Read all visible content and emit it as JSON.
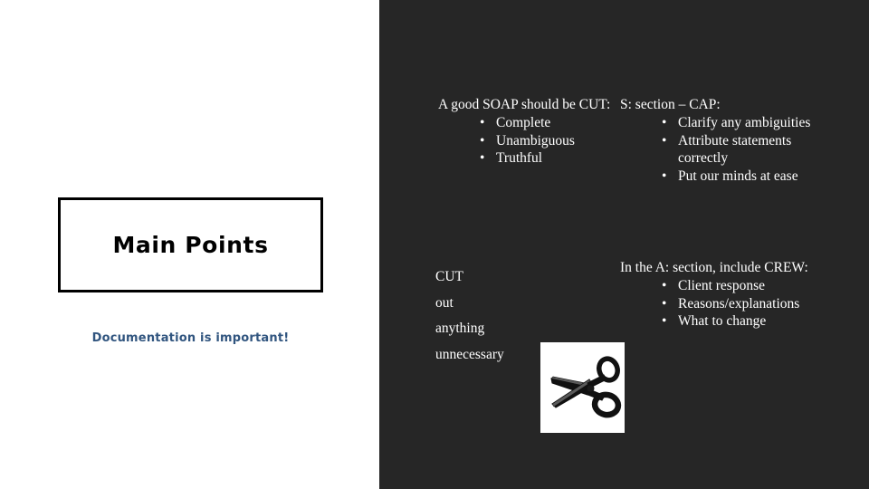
{
  "slide": {
    "title": "Main Points",
    "subtitle": "Documentation is important!",
    "accent_color": "#31557f",
    "panel_color": "#262626",
    "text_color": "#ffffff"
  },
  "columns": {
    "soap": {
      "lead": "A good SOAP should be CUT:",
      "bullet_glyph": "•",
      "bullets": [
        "Complete",
        "Unambiguous",
        "Truthful"
      ]
    },
    "cap": {
      "lead": "S: section – CAP:",
      "bullet_glyph": "•",
      "bullets": [
        "Clarify any ambiguities",
        "Attribute statements correctly",
        "Put our minds at ease"
      ]
    },
    "cut_out": {
      "lines": [
        "CUT",
        "out",
        "anything",
        "unnecessary"
      ]
    },
    "crew": {
      "lead": "In the A: section, include CREW:",
      "bullet_glyph": "•",
      "bullets": [
        "Client response",
        "Reasons/explanations",
        "What to change"
      ]
    }
  },
  "image": {
    "scissors_alt": "scissors-clipart"
  }
}
